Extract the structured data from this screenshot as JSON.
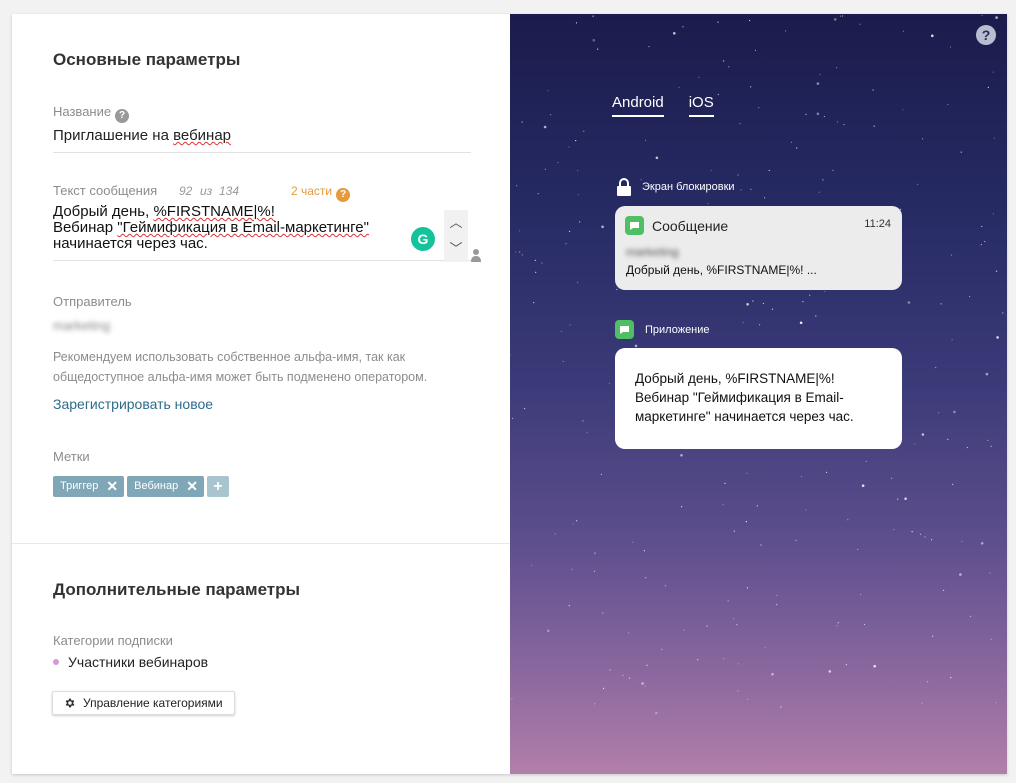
{
  "main_section": {
    "title": "Основные параметры",
    "name_label": "Название",
    "name_value": "Приглашение на вебинар",
    "message_label": "Текст сообщения",
    "char_count": "92",
    "char_of": "из",
    "char_max": "134",
    "parts": "2 части",
    "message_line1_prefix": "Добрый день,  ",
    "message_line1_var": "%FIRSTNAME|%!",
    "message_line2_prefix": "Вебинар ",
    "message_line2_title": "\"Геймификация в Email-маркетинге\"",
    "message_line3": "начинается через час.",
    "sender_label": "Отправитель",
    "sender_value": "marketing",
    "hint": "Рекомендуем использовать собственное альфа-имя, так как общедоступное альфа-имя может быть подменено оператором.",
    "register_link": "Зарегистрировать новое",
    "tags_label": "Метки",
    "tags": [
      "Триггер",
      "Вебинар"
    ],
    "tag_remove_glyph": "✕",
    "tag_add_glyph": "+"
  },
  "additional_section": {
    "title": "Дополнительные параметры",
    "categories_label": "Категории подписки",
    "category_item": "Участники вебинаров",
    "manage_button": "Управление категориями"
  },
  "preview": {
    "help_glyph": "?",
    "tabs": [
      "Android",
      "iOS"
    ],
    "lock_screen_label": "Экран блокировки",
    "notif_app": "Сообщение",
    "notif_time": "11:24",
    "notif_sender": "marketing",
    "notif_preview": "Добрый день, %FIRSTNAME|%! ...",
    "app_label": "Приложение",
    "app_message": "Добрый день,  %FIRSTNAME|%! Вебинар \"Геймификация в Email-маркетинге\" начинается через час."
  },
  "icons": {
    "help": "question-circle-icon",
    "grammarly": "grammarly-icon",
    "lock": "lock-icon",
    "message": "message-bubble-icon",
    "gear": "gear-icon",
    "user": "user-icon"
  },
  "colors": {
    "accent_orange": "#e69a3b",
    "link": "#2d6d8c",
    "tag_bg": "#7fa7b7",
    "message_app_green": "#4fbf63"
  }
}
